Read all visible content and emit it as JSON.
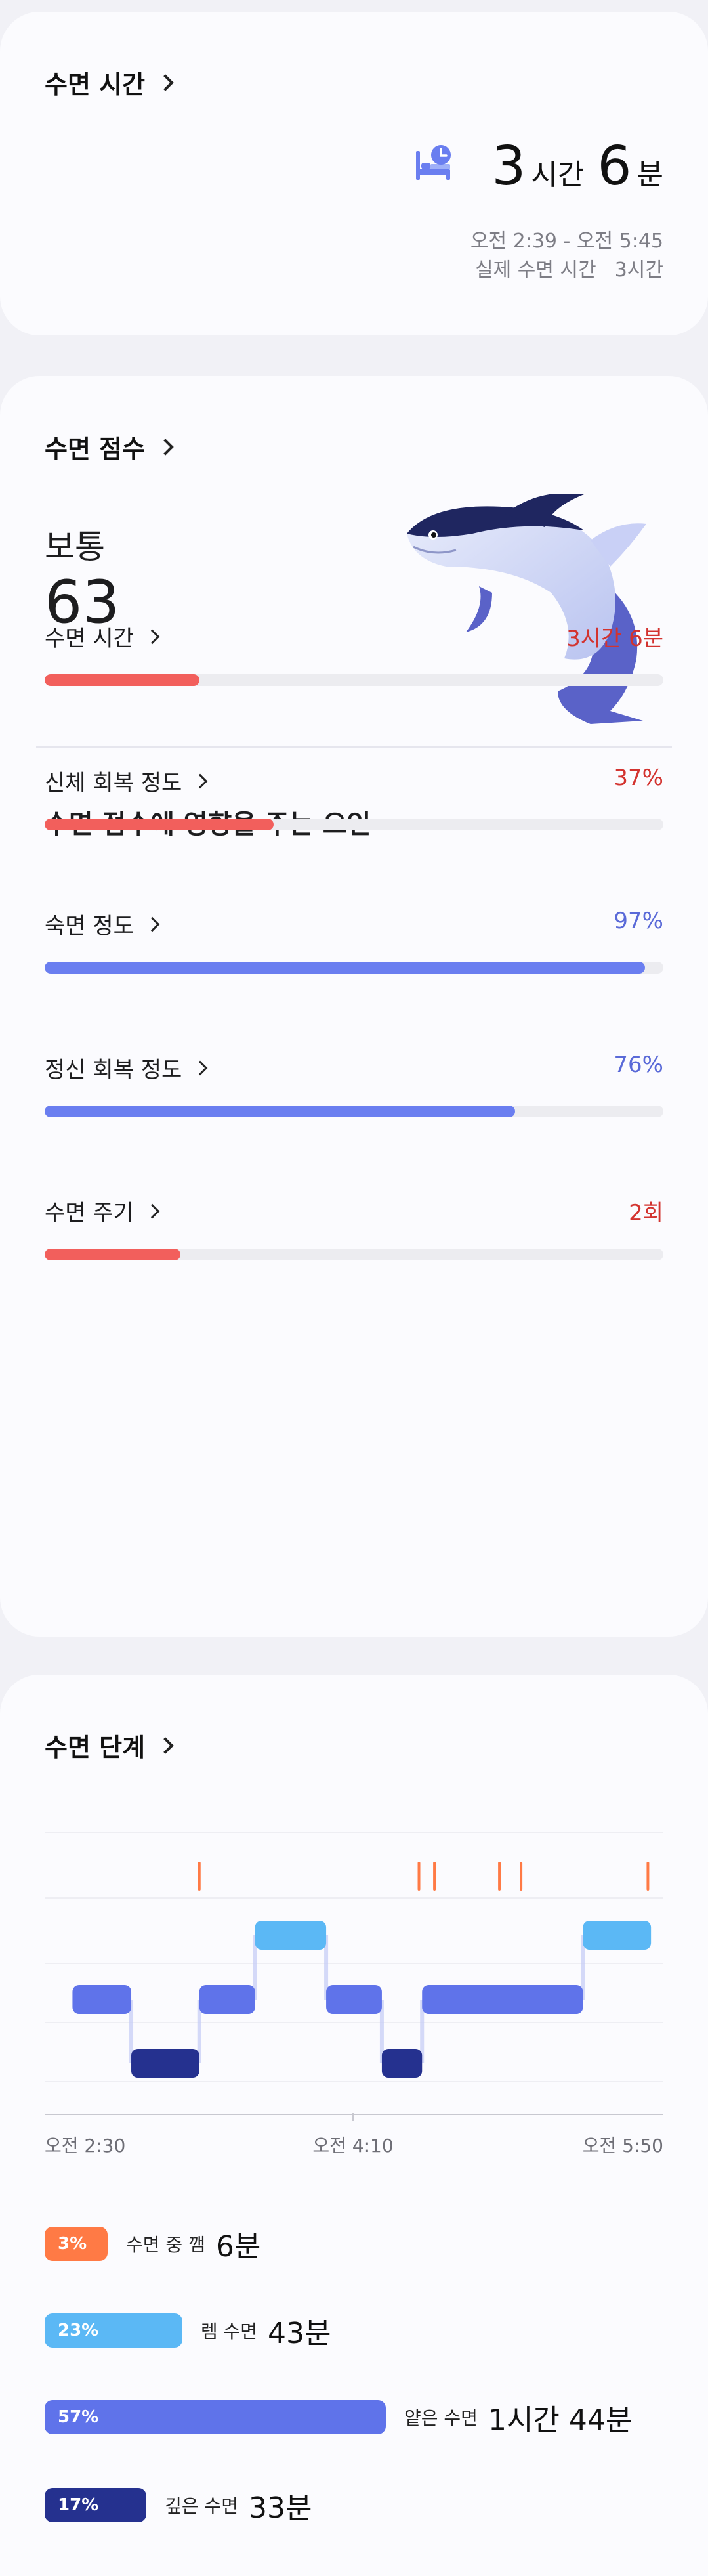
{
  "sleep_time": {
    "header": "수면 시간",
    "hours": "3",
    "hours_unit": "시간",
    "minutes": "6",
    "minutes_unit": "분",
    "range": "오전 2:39 - 오전 5:45",
    "actual_label": "실제 수면 시간",
    "actual_value": "3시간"
  },
  "score": {
    "header": "수면 점수",
    "label": "보통",
    "value": "63",
    "factors_title": "수면 점수에 영향을 주는 요인",
    "factors": [
      {
        "label": "수면 시간",
        "value": "3시간 6분",
        "progress": 0.25,
        "color": "#f25f5c",
        "text_color": "#d3332f"
      },
      {
        "label": "신체 회복 정도",
        "value": "37%",
        "progress": 0.37,
        "color": "#f25f5c",
        "text_color": "#d3332f"
      },
      {
        "label": "숙면 정도",
        "value": "97%",
        "progress": 0.97,
        "color": "#6a7ef0",
        "text_color": "#5a6ad8"
      },
      {
        "label": "정신 회복 정도",
        "value": "76%",
        "progress": 0.76,
        "color": "#6a7ef0",
        "text_color": "#5a6ad8"
      },
      {
        "label": "수면 주기",
        "value": "2회",
        "progress": 0.22,
        "color": "#f25f5c",
        "text_color": "#d3332f"
      }
    ]
  },
  "stages": {
    "header": "수면 단계",
    "x_ticks": [
      "오전 2:30",
      "오전 4:10",
      "오전 5:50"
    ],
    "legend": [
      {
        "pct": "3%",
        "name": "수면 중 깸",
        "duration": "6분",
        "color": "#ff7a45"
      },
      {
        "pct": "23%",
        "name": "렘 수면",
        "duration": "43분",
        "color": "#5bb8f5"
      },
      {
        "pct": "57%",
        "name": "얕은 수면",
        "duration": "1시간 44분",
        "color": "#5f73ea"
      },
      {
        "pct": "17%",
        "name": "깊은 수면",
        "duration": "33분",
        "color": "#25318f"
      }
    ]
  },
  "chart_data": {
    "type": "area",
    "title": "",
    "xlabel": "",
    "ylabel": "",
    "x_ticks": [
      "오전 2:30",
      "오전 4:10",
      "오전 5:50"
    ],
    "x_range_minutes": [
      0,
      200
    ],
    "stage_levels": [
      "awake",
      "rem",
      "light",
      "deep"
    ],
    "segments": [
      {
        "stage": "light",
        "start": 9,
        "end": 28
      },
      {
        "stage": "deep",
        "start": 28,
        "end": 50
      },
      {
        "stage": "light",
        "start": 50,
        "end": 68
      },
      {
        "stage": "rem",
        "start": 68,
        "end": 91
      },
      {
        "stage": "light",
        "start": 91,
        "end": 109
      },
      {
        "stage": "deep",
        "start": 109,
        "end": 122
      },
      {
        "stage": "light",
        "start": 122,
        "end": 174
      },
      {
        "stage": "rem",
        "start": 174,
        "end": 196
      }
    ],
    "awake_marks": [
      50,
      121,
      126,
      147,
      154,
      195
    ]
  }
}
